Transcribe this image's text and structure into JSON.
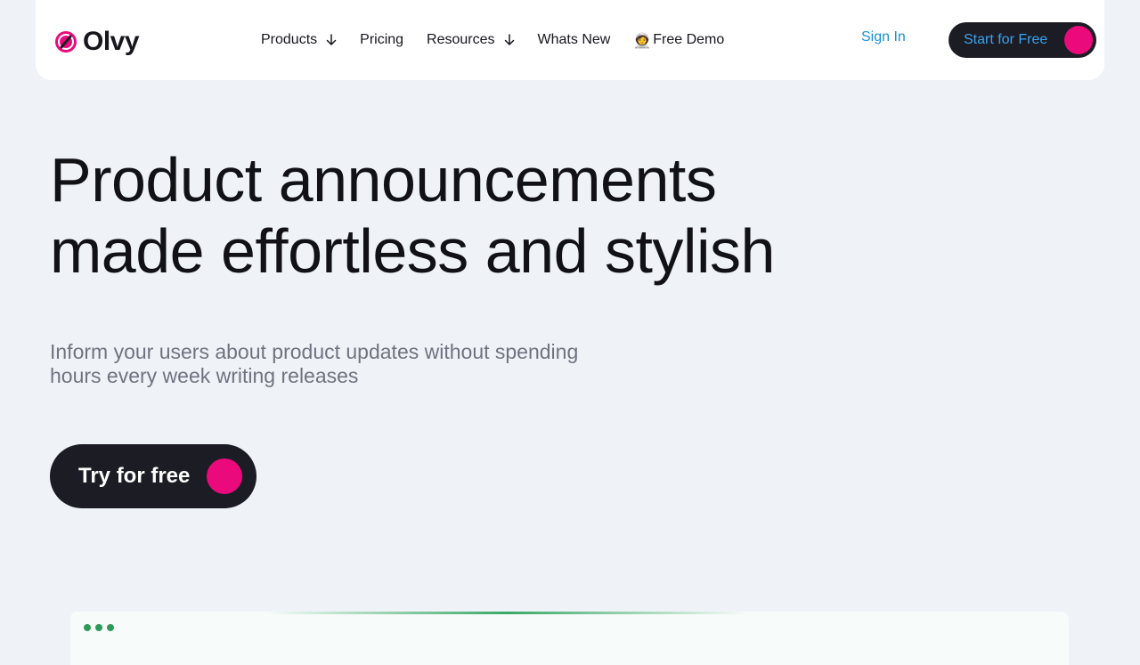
{
  "brand": {
    "name": "Olvy",
    "logo_icon": "olvy-logo-icon",
    "accent_color": "#ea0a7b",
    "dark_color": "#1c1c24",
    "link_color": "#1d90d6"
  },
  "nav": {
    "items": [
      {
        "label": "Products",
        "has_dropdown": true
      },
      {
        "label": "Pricing",
        "has_dropdown": false
      },
      {
        "label": "Resources",
        "has_dropdown": true
      },
      {
        "label": "Whats New",
        "has_dropdown": false
      },
      {
        "label": "Free Demo",
        "emoji": "🧑‍🚀",
        "has_dropdown": false
      }
    ],
    "sign_in": "Sign In",
    "cta": "Start for Free"
  },
  "hero": {
    "title_line1": "Product announcements",
    "title_line2": "made effortless and stylish",
    "subtitle_line1": "Inform your users about product updates without spending",
    "subtitle_line2": "hours every week writing releases",
    "cta": "Try for free"
  },
  "preview": {
    "window_dot_color": "#2e9a5a"
  }
}
